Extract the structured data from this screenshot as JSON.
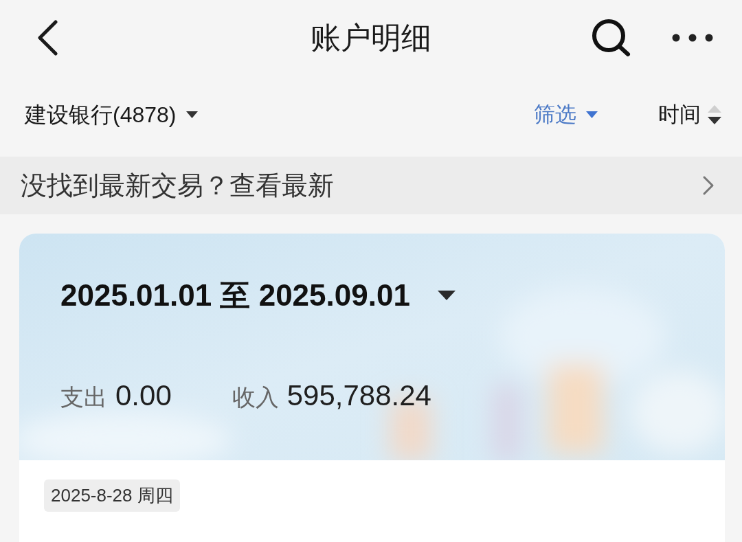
{
  "header": {
    "title": "账户明细"
  },
  "filter_bar": {
    "account": "建设银行(4878)",
    "filter": "筛选",
    "sort": {
      "label": "时间",
      "descending": true
    }
  },
  "notice": {
    "text": "没找到最新交易？查看最新"
  },
  "summary": {
    "date_range": "2025.01.01 至 2025.09.01",
    "expense": {
      "label": "支出",
      "amount": "0.00"
    },
    "income": {
      "label": "收入",
      "amount": "595,788.24"
    }
  },
  "transactions": [
    {
      "date": "2025-8-28 周四"
    }
  ]
}
